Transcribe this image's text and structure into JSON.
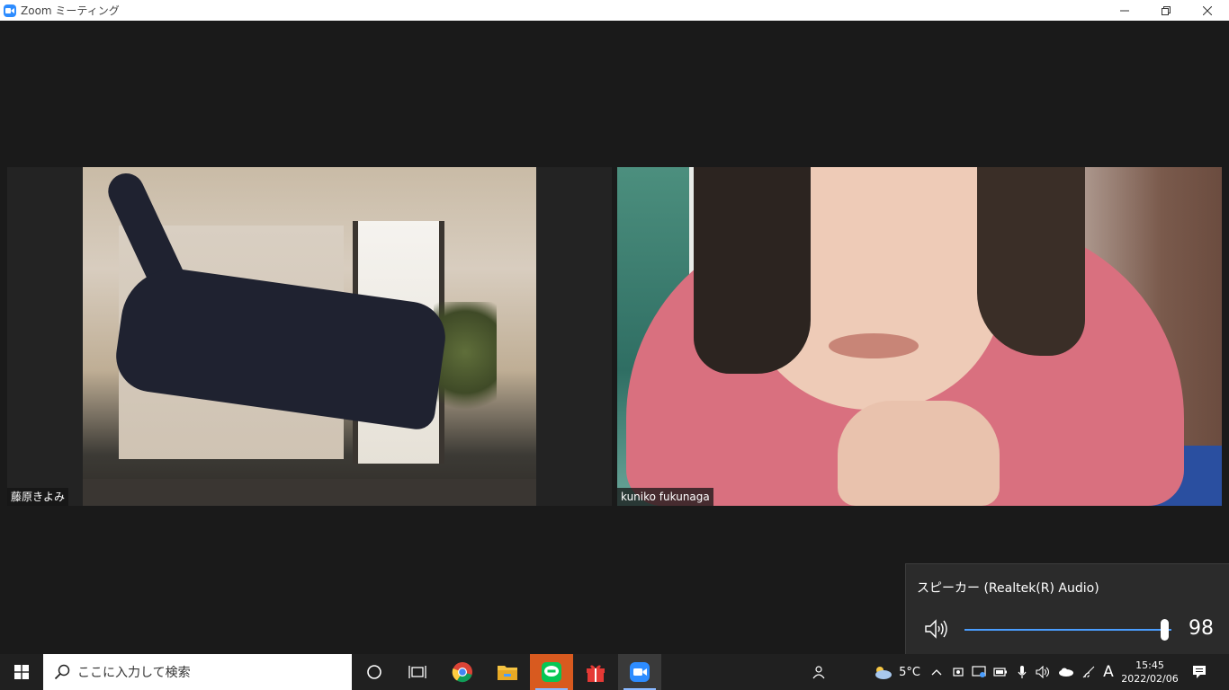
{
  "window": {
    "title": "Zoom ミーティング"
  },
  "participants": [
    {
      "name": "藤原きよみ"
    },
    {
      "name": "kuniko fukunaga"
    }
  ],
  "volume_flyout": {
    "device_label": "スピーカー (Realtek(R) Audio)",
    "level": 98,
    "level_text": "98",
    "accent_color": "#4a9eff"
  },
  "taskbar": {
    "search_placeholder": "ここに入力して検索",
    "pinned_apps": [
      "cortana-icon",
      "task-view-icon",
      "chrome-icon",
      "file-explorer-icon",
      "line-icon",
      "gift-icon",
      "zoom-icon"
    ],
    "weather_temp": "5°C",
    "ime_indicator": "A",
    "time": "15:45",
    "date": "2022/02/06"
  }
}
